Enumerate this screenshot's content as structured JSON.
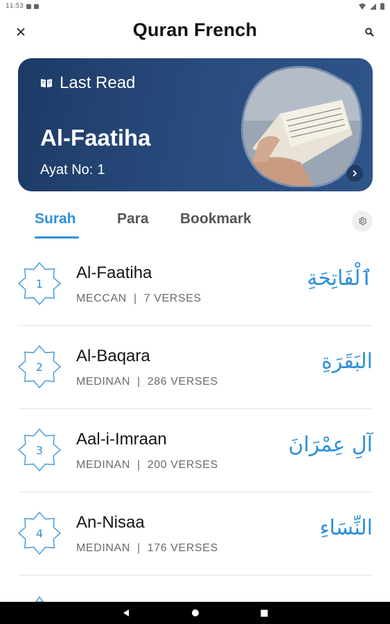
{
  "status_bar": {
    "time": "11:53"
  },
  "app_bar": {
    "title": "Quran French"
  },
  "last_read": {
    "header": "Last Read",
    "surah": "Al-Faatiha",
    "ayat_label": "Ayat No:",
    "ayat_value": "1"
  },
  "tabs": [
    {
      "label": "Surah",
      "active": true
    },
    {
      "label": "Para",
      "active": false
    },
    {
      "label": "Bookmark",
      "active": false
    }
  ],
  "surahs": [
    {
      "number": "1",
      "name": "Al-Faatiha",
      "type": "MECCAN",
      "verses": "7 VERSES",
      "arabic": "ٱلْفَاتِحَةِ"
    },
    {
      "number": "2",
      "name": "Al-Baqara",
      "type": "MEDINAN",
      "verses": "286 VERSES",
      "arabic": "البَقَرَةِ"
    },
    {
      "number": "3",
      "name": "Aal-i-Imraan",
      "type": "MEDINAN",
      "verses": "200 VERSES",
      "arabic": "آلِ عِمْرَانَ"
    },
    {
      "number": "4",
      "name": "An-Nisaa",
      "type": "MEDINAN",
      "verses": "176 VERSES",
      "arabic": "النِّسَاءِ"
    }
  ],
  "meta_separator": "|",
  "colors": {
    "accent": "#2f90d8",
    "card_bg": "#1d3a66"
  },
  "icons": {
    "close": "close-icon",
    "search": "search-icon",
    "book": "book-icon",
    "settings": "gear-icon",
    "arrow": "chevron-right-icon"
  }
}
